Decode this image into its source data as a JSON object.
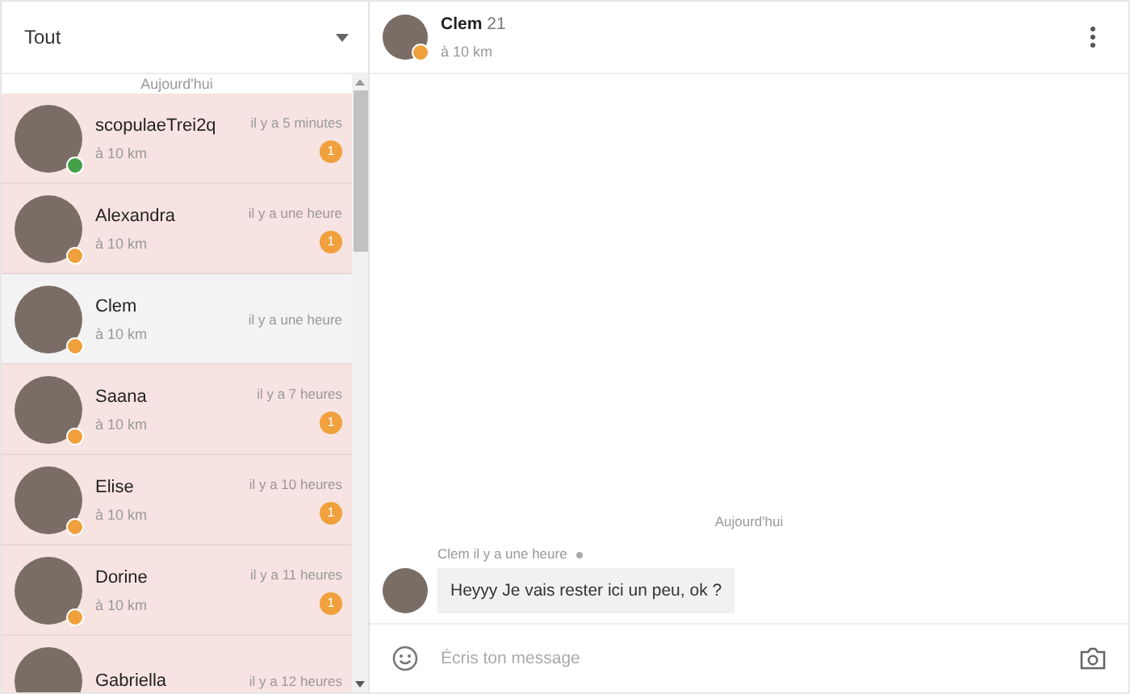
{
  "filter": {
    "value": "Tout"
  },
  "list_header": "Aujourd'hui",
  "conversations": [
    {
      "name": "scopulaeTrei2q",
      "distance": "à 10 km",
      "time": "il y a 5 minutes",
      "badge": "1",
      "selected": false,
      "color": "#43a047"
    },
    {
      "name": "Alexandra",
      "distance": "à 10 km",
      "time": "il y a une heure",
      "badge": "1",
      "selected": false,
      "color": "#f0a03c"
    },
    {
      "name": "Clem",
      "distance": "à 10 km",
      "time": "il y a une heure",
      "selected": true,
      "color": "#f0a03c"
    },
    {
      "name": "Saana",
      "distance": "à 10 km",
      "time": "il y a 7 heures",
      "badge": "1",
      "selected": false,
      "color": "#f0a03c"
    },
    {
      "name": "Elise",
      "distance": "à 10 km",
      "time": "il y a 10 heures",
      "badge": "1",
      "selected": false,
      "color": "#f0a03c"
    },
    {
      "name": "Dorine",
      "distance": "à 10 km",
      "time": "il y a 11 heures",
      "badge": "1",
      "selected": false,
      "color": "#f0a03c"
    },
    {
      "name": "Gabriella",
      "time": "il y a 12 heures",
      "selected": false
    }
  ],
  "chat_header": {
    "name": "Clem",
    "age": "21",
    "distance": "à 10 km",
    "color": "#f0a03c"
  },
  "day_label": "Aujourd'hui",
  "messages": [
    {
      "sender": "Clem",
      "time": "il y a une heure",
      "text": "Heyyy Je vais rester ici un peu, ok ?"
    }
  ],
  "composer": {
    "placeholder": "Écris ton message"
  }
}
